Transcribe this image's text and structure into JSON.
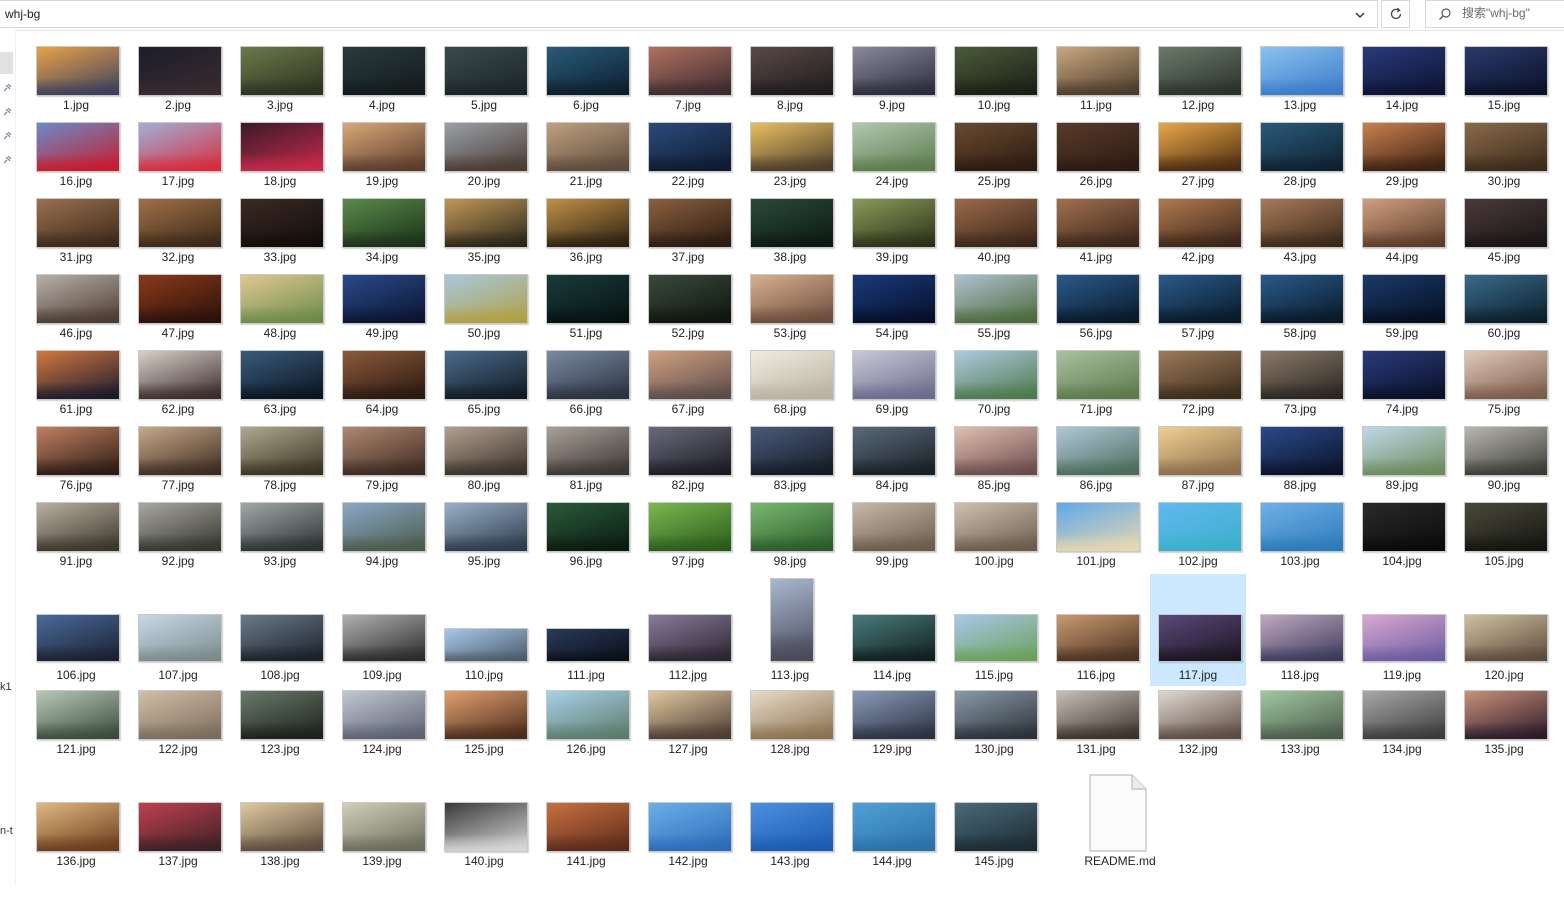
{
  "address_bar": {
    "path": "whj-bg",
    "search_placeholder": "搜索\"whj-bg\""
  },
  "nav_pane": {
    "fragments": [
      "k1",
      "n-t"
    ]
  },
  "selected_file": "117.jpg",
  "files": [
    {
      "name": "1.jpg",
      "colors": [
        "#e8a24a",
        "#3a3f5c"
      ]
    },
    {
      "name": "2.jpg",
      "colors": [
        "#1c1e2a",
        "#3a2a30"
      ]
    },
    {
      "name": "3.jpg",
      "colors": [
        "#6b7a4a",
        "#2c3020"
      ]
    },
    {
      "name": "4.jpg",
      "colors": [
        "#2a3a3e",
        "#121a1c"
      ]
    },
    {
      "name": "5.jpg",
      "colors": [
        "#3a4a4c",
        "#1a2426"
      ]
    },
    {
      "name": "6.jpg",
      "colors": [
        "#2a5a7a",
        "#0c1e2c"
      ]
    },
    {
      "name": "7.jpg",
      "colors": [
        "#b07060",
        "#3a2a2e"
      ]
    },
    {
      "name": "8.jpg",
      "colors": [
        "#5a4a46",
        "#1e1a1c"
      ]
    },
    {
      "name": "9.jpg",
      "colors": [
        "#8a8a9a",
        "#2a2a3a"
      ]
    },
    {
      "name": "10.jpg",
      "colors": [
        "#4a5a3a",
        "#1a1e14"
      ]
    },
    {
      "name": "11.jpg",
      "colors": [
        "#c8a880",
        "#4a3a2a"
      ]
    },
    {
      "name": "12.jpg",
      "colors": [
        "#6a7a6a",
        "#2a302a"
      ]
    },
    {
      "name": "13.jpg",
      "colors": [
        "#8ac2f0",
        "#3a7ac8"
      ]
    },
    {
      "name": "14.jpg",
      "colors": [
        "#2a3a7a",
        "#0c1230"
      ]
    },
    {
      "name": "15.jpg",
      "colors": [
        "#2a3a6a",
        "#0a1028"
      ]
    },
    {
      "name": "16.jpg",
      "colors": [
        "#6a8ac8",
        "#c81a2a"
      ]
    },
    {
      "name": "17.jpg",
      "colors": [
        "#a0b0d8",
        "#d82a3a"
      ]
    },
    {
      "name": "18.jpg",
      "colors": [
        "#3a1a2a",
        "#c82a4a"
      ]
    },
    {
      "name": "19.jpg",
      "colors": [
        "#d8a878",
        "#5a3a2a"
      ]
    },
    {
      "name": "20.jpg",
      "colors": [
        "#9aa0a8",
        "#4a3a30"
      ]
    },
    {
      "name": "21.jpg",
      "colors": [
        "#c0a080",
        "#5a4a3a"
      ]
    },
    {
      "name": "22.jpg",
      "colors": [
        "#2a4a7a",
        "#0e1a30"
      ]
    },
    {
      "name": "23.jpg",
      "colors": [
        "#e8c060",
        "#4a3a2a"
      ]
    },
    {
      "name": "24.jpg",
      "colors": [
        "#b0c8b0",
        "#5a7a4a"
      ]
    },
    {
      "name": "25.jpg",
      "colors": [
        "#6a4a30",
        "#2a1a10"
      ]
    },
    {
      "name": "26.jpg",
      "colors": [
        "#5a3a2a",
        "#2a1a12"
      ]
    },
    {
      "name": "27.jpg",
      "colors": [
        "#e8a848",
        "#4a2a10"
      ]
    },
    {
      "name": "28.jpg",
      "colors": [
        "#2a5a7a",
        "#0e2030"
      ]
    },
    {
      "name": "29.jpg",
      "colors": [
        "#c88050",
        "#3a2010"
      ]
    },
    {
      "name": "30.jpg",
      "colors": [
        "#8a6a4a",
        "#3a2a1a"
      ]
    },
    {
      "name": "31.jpg",
      "colors": [
        "#9a7050",
        "#3a2818"
      ]
    },
    {
      "name": "32.jpg",
      "colors": [
        "#a07048",
        "#3a2818"
      ]
    },
    {
      "name": "33.jpg",
      "colors": [
        "#3a2a24",
        "#120c0a"
      ]
    },
    {
      "name": "34.jpg",
      "colors": [
        "#5a8a4a",
        "#1a3018"
      ]
    },
    {
      "name": "35.jpg",
      "colors": [
        "#c09858",
        "#2a2418"
      ]
    },
    {
      "name": "36.jpg",
      "colors": [
        "#c09048",
        "#2a2010"
      ]
    },
    {
      "name": "37.jpg",
      "colors": [
        "#8a6040",
        "#2a1a10"
      ]
    },
    {
      "name": "38.jpg",
      "colors": [
        "#2a4a3a",
        "#0c1812"
      ]
    },
    {
      "name": "39.jpg",
      "colors": [
        "#8a9a5a",
        "#2a3018"
      ]
    },
    {
      "name": "40.jpg",
      "colors": [
        "#9a6a4a",
        "#3a2418"
      ]
    },
    {
      "name": "41.jpg",
      "colors": [
        "#a07050",
        "#3a2418"
      ]
    },
    {
      "name": "42.jpg",
      "colors": [
        "#b07a50",
        "#3a2418"
      ]
    },
    {
      "name": "43.jpg",
      "colors": [
        "#a87a5a",
        "#3a2818"
      ]
    },
    {
      "name": "44.jpg",
      "colors": [
        "#d0a080",
        "#5a3a28"
      ]
    },
    {
      "name": "45.jpg",
      "colors": [
        "#4a3a3a",
        "#1a1414"
      ]
    },
    {
      "name": "46.jpg",
      "colors": [
        "#b8b0a8",
        "#4a3a30"
      ]
    },
    {
      "name": "47.jpg",
      "colors": [
        "#8a3a1a",
        "#2a100a"
      ]
    },
    {
      "name": "48.jpg",
      "colors": [
        "#e0c890",
        "#6a8a4a"
      ]
    },
    {
      "name": "49.jpg",
      "colors": [
        "#2a4a8a",
        "#0a1430"
      ]
    },
    {
      "name": "50.jpg",
      "colors": [
        "#a8c8e0",
        "#b0a040"
      ]
    },
    {
      "name": "51.jpg",
      "colors": [
        "#1a3a3a",
        "#061212"
      ]
    },
    {
      "name": "52.jpg",
      "colors": [
        "#3a4a3a",
        "#0e140e"
      ]
    },
    {
      "name": "53.jpg",
      "colors": [
        "#d8b090",
        "#6a4a3a"
      ]
    },
    {
      "name": "54.jpg",
      "colors": [
        "#1a3a7a",
        "#050e28"
      ]
    },
    {
      "name": "55.jpg",
      "colors": [
        "#b0c0d0",
        "#4a6a3a"
      ]
    },
    {
      "name": "56.jpg",
      "colors": [
        "#2a5a8a",
        "#081828"
      ]
    },
    {
      "name": "57.jpg",
      "colors": [
        "#2a5a8a",
        "#081828"
      ]
    },
    {
      "name": "58.jpg",
      "colors": [
        "#2a5a8a",
        "#081828"
      ]
    },
    {
      "name": "59.jpg",
      "colors": [
        "#1a3a6a",
        "#050e20"
      ]
    },
    {
      "name": "60.jpg",
      "colors": [
        "#3a6a8a",
        "#0a1e2a"
      ]
    },
    {
      "name": "61.jpg",
      "colors": [
        "#d07840",
        "#1a1a2a"
      ]
    },
    {
      "name": "62.jpg",
      "colors": [
        "#d8d0c8",
        "#3a2a2a"
      ]
    },
    {
      "name": "63.jpg",
      "colors": [
        "#3a5a7a",
        "#0a1420"
      ]
    },
    {
      "name": "64.jpg",
      "colors": [
        "#8a5a3a",
        "#2a1810"
      ]
    },
    {
      "name": "65.jpg",
      "colors": [
        "#4a6a8a",
        "#101a24"
      ]
    },
    {
      "name": "66.jpg",
      "colors": [
        "#7a8aa0",
        "#2a3040"
      ]
    },
    {
      "name": "67.jpg",
      "colors": [
        "#d0a080",
        "#5a4a4a"
      ]
    },
    {
      "name": "68.jpg",
      "colors": [
        "#f0ece0",
        "#b8b0a0"
      ]
    },
    {
      "name": "69.jpg",
      "colors": [
        "#c8c8d8",
        "#6a6a8a"
      ]
    },
    {
      "name": "70.jpg",
      "colors": [
        "#b0c8e0",
        "#4a7a4a"
      ]
    },
    {
      "name": "71.jpg",
      "colors": [
        "#a8c0a0",
        "#5a7a4a"
      ]
    },
    {
      "name": "72.jpg",
      "colors": [
        "#9a7a5a",
        "#3a2a1a"
      ]
    },
    {
      "name": "73.jpg",
      "colors": [
        "#8a7a6a",
        "#2a2420"
      ]
    },
    {
      "name": "74.jpg",
      "colors": [
        "#2a3a7a",
        "#0a1028"
      ]
    },
    {
      "name": "75.jpg",
      "colors": [
        "#e0c8b8",
        "#7a5a4a"
      ]
    },
    {
      "name": "76.jpg",
      "colors": [
        "#c08060",
        "#2a1a14"
      ]
    },
    {
      "name": "77.jpg",
      "colors": [
        "#c8a888",
        "#3a2a20"
      ]
    },
    {
      "name": "78.jpg",
      "colors": [
        "#b0a890",
        "#3a3020"
      ]
    },
    {
      "name": "79.jpg",
      "colors": [
        "#b08870",
        "#3a2820"
      ]
    },
    {
      "name": "80.jpg",
      "colors": [
        "#b0a090",
        "#3a3028"
      ]
    },
    {
      "name": "81.jpg",
      "colors": [
        "#a8a098",
        "#3a3430"
      ]
    },
    {
      "name": "82.jpg",
      "colors": [
        "#6a6a7a",
        "#1a1a24"
      ]
    },
    {
      "name": "83.jpg",
      "colors": [
        "#4a5a7a",
        "#141a24"
      ]
    },
    {
      "name": "84.jpg",
      "colors": [
        "#5a6a7a",
        "#181e24"
      ]
    },
    {
      "name": "85.jpg",
      "colors": [
        "#e0c0b0",
        "#6a4a4a"
      ]
    },
    {
      "name": "86.jpg",
      "colors": [
        "#b0c8d8",
        "#4a6a5a"
      ]
    },
    {
      "name": "87.jpg",
      "colors": [
        "#f0d090",
        "#8a6a4a"
      ]
    },
    {
      "name": "88.jpg",
      "colors": [
        "#2a4a8a",
        "#0a1228"
      ]
    },
    {
      "name": "89.jpg",
      "colors": [
        "#c0d8e8",
        "#6a8a5a"
      ]
    },
    {
      "name": "90.jpg",
      "colors": [
        "#b8b8b0",
        "#3a3a34"
      ]
    },
    {
      "name": "91.jpg",
      "colors": [
        "#b8b0a0",
        "#3a342a"
      ]
    },
    {
      "name": "92.jpg",
      "colors": [
        "#a8a8a0",
        "#34342e"
      ]
    },
    {
      "name": "93.jpg",
      "colors": [
        "#a0a8a8",
        "#2a3030"
      ]
    },
    {
      "name": "94.jpg",
      "colors": [
        "#8aa8c8",
        "#4a5a4a"
      ]
    },
    {
      "name": "95.jpg",
      "colors": [
        "#9ab0c8",
        "#2a3a4a"
      ]
    },
    {
      "name": "96.jpg",
      "colors": [
        "#2a5a3a",
        "#0a1a10"
      ]
    },
    {
      "name": "97.jpg",
      "colors": [
        "#7ab850",
        "#2a5a1a"
      ]
    },
    {
      "name": "98.jpg",
      "colors": [
        "#7ab870",
        "#2a5a2a"
      ]
    },
    {
      "name": "99.jpg",
      "colors": [
        "#c8b8a8",
        "#6a5a4a"
      ]
    },
    {
      "name": "100.jpg",
      "colors": [
        "#d0c0b0",
        "#6a5a4a"
      ]
    },
    {
      "name": "101.jpg",
      "colors": [
        "#60a8e8",
        "#e8d8b0"
      ]
    },
    {
      "name": "102.jpg",
      "colors": [
        "#60b8f0",
        "#3ab0c8"
      ]
    },
    {
      "name": "103.jpg",
      "colors": [
        "#70b0e8",
        "#2a7ab8"
      ]
    },
    {
      "name": "104.jpg",
      "colors": [
        "#2a2a2a",
        "#0a0a0a"
      ]
    },
    {
      "name": "105.jpg",
      "colors": [
        "#4a4a3a",
        "#141410"
      ]
    },
    {
      "name": "106.jpg",
      "colors": [
        "#4a6a9a",
        "#1a2030"
      ]
    },
    {
      "name": "107.jpg",
      "colors": [
        "#c8d8e8",
        "#7a8a8a"
      ]
    },
    {
      "name": "108.jpg",
      "colors": [
        "#6a7a8a",
        "#1a2028"
      ]
    },
    {
      "name": "109.jpg",
      "colors": [
        "#b0b0b0",
        "#2a2a2a"
      ]
    },
    {
      "name": "110.jpg",
      "colors": [
        "#a8c8e8",
        "#4a5a6a"
      ]
    },
    {
      "name": "111.jpg",
      "colors": [
        "#2a3a5a",
        "#0a0e18"
      ]
    },
    {
      "name": "112.jpg",
      "colors": [
        "#8a7a9a",
        "#2a2430"
      ]
    },
    {
      "name": "113.jpg",
      "colors": [
        "#a8b8d0",
        "#4a4a5a"
      ]
    },
    {
      "name": "114.jpg",
      "colors": [
        "#4a7a7a",
        "#101e1e"
      ]
    },
    {
      "name": "115.jpg",
      "colors": [
        "#a8c8e8",
        "#6aa05a"
      ]
    },
    {
      "name": "116.jpg",
      "colors": [
        "#c89a70",
        "#4a3020"
      ]
    },
    {
      "name": "117.jpg",
      "colors": [
        "#5a4a7a",
        "#1a1420"
      ]
    },
    {
      "name": "118.jpg",
      "colors": [
        "#c0a8c0",
        "#3a3a5a"
      ]
    },
    {
      "name": "119.jpg",
      "colors": [
        "#d8a8d0",
        "#6a5aa0"
      ]
    },
    {
      "name": "120.jpg",
      "colors": [
        "#d0c0a0",
        "#5a4a3a"
      ]
    },
    {
      "name": "121.jpg",
      "colors": [
        "#b8c8b8",
        "#3a4a3a"
      ]
    },
    {
      "name": "122.jpg",
      "colors": [
        "#d0c0a8",
        "#7a6a5a"
      ]
    },
    {
      "name": "123.jpg",
      "colors": [
        "#6a7a6a",
        "#1a201a"
      ]
    },
    {
      "name": "124.jpg",
      "colors": [
        "#c0c8d0",
        "#5a6070"
      ]
    },
    {
      "name": "125.jpg",
      "colors": [
        "#e0a070",
        "#4a2a1a"
      ]
    },
    {
      "name": "126.jpg",
      "colors": [
        "#a8d0e8",
        "#5a7a6a"
      ]
    },
    {
      "name": "127.jpg",
      "colors": [
        "#e0c8a0",
        "#4a3a30"
      ]
    },
    {
      "name": "128.jpg",
      "colors": [
        "#e8dcc8",
        "#8a7050"
      ]
    },
    {
      "name": "129.jpg",
      "colors": [
        "#8a9ab8",
        "#2a3040"
      ]
    },
    {
      "name": "130.jpg",
      "colors": [
        "#8a9aa8",
        "#2a3038"
      ]
    },
    {
      "name": "131.jpg",
      "colors": [
        "#c8c0b8",
        "#3a302a"
      ]
    },
    {
      "name": "132.jpg",
      "colors": [
        "#e0d8d0",
        "#5a4a40"
      ]
    },
    {
      "name": "133.jpg",
      "colors": [
        "#a0c8a0",
        "#4a5a4a"
      ]
    },
    {
      "name": "134.jpg",
      "colors": [
        "#a8a8a8",
        "#3a3a3a"
      ]
    },
    {
      "name": "135.jpg",
      "colors": [
        "#c89078",
        "#2a1a2a"
      ]
    },
    {
      "name": "136.jpg",
      "colors": [
        "#e0b880",
        "#6a3a1a"
      ]
    },
    {
      "name": "137.jpg",
      "colors": [
        "#c04050",
        "#3a2024"
      ]
    },
    {
      "name": "138.jpg",
      "colors": [
        "#e0c8a0",
        "#5a4a3a"
      ]
    },
    {
      "name": "139.jpg",
      "colors": [
        "#d0d0b8",
        "#6a6a5a"
      ]
    },
    {
      "name": "140.jpg",
      "colors": [
        "#3a3a3a",
        "#d8d8d8"
      ]
    },
    {
      "name": "141.jpg",
      "colors": [
        "#c87040",
        "#5a2a1a"
      ]
    },
    {
      "name": "142.jpg",
      "colors": [
        "#6ab0e8",
        "#2a6ab8"
      ]
    },
    {
      "name": "143.jpg",
      "colors": [
        "#4a90e0",
        "#1a5ab0"
      ]
    },
    {
      "name": "144.jpg",
      "colors": [
        "#50a0d8",
        "#2a70a8"
      ]
    },
    {
      "name": "145.jpg",
      "colors": [
        "#4a6a7a",
        "#1a2a30"
      ]
    },
    {
      "name": "README.md",
      "type": "file"
    }
  ]
}
